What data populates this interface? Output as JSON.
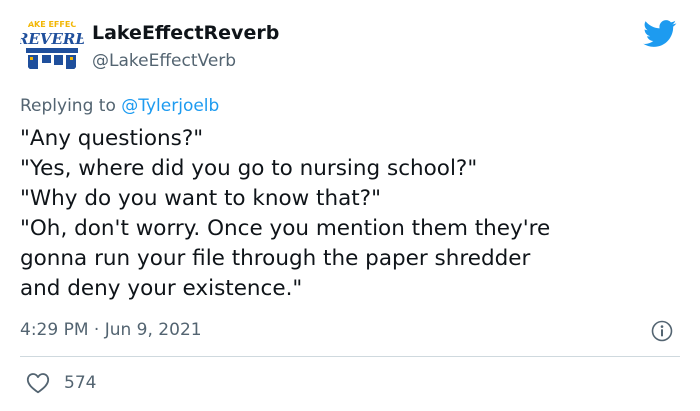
{
  "tweet": {
    "display_name": "LakeEffectReverb",
    "handle": "@LakeEffectVerb",
    "avatar_text": {
      "top": "AKE EFFEC",
      "main": "REVERB"
    },
    "replying_prefix": "Replying to ",
    "replying_to": "@Tylerjoelb",
    "lines": [
      "\"Any questions?\"",
      "\"Yes, where did you go to nursing school?\"",
      "\"Why do you want to know that?\"",
      "\"Oh, don't worry. Once you mention them they're",
      "gonna run your file through the paper shredder",
      "and deny your existence.\""
    ],
    "time": "4:29 PM",
    "separator": "·",
    "date": "Jun 9, 2021",
    "like_count": "574"
  },
  "icons": {
    "brand": "twitter-bird-icon",
    "info": "info-icon",
    "like": "heart-icon"
  },
  "colors": {
    "accent": "#1d9bf0",
    "text": "#0f1419",
    "secondary": "#536471",
    "divider": "#cfd9de",
    "logo_blue": "#1f4f9c",
    "logo_yellow": "#f2b705"
  }
}
